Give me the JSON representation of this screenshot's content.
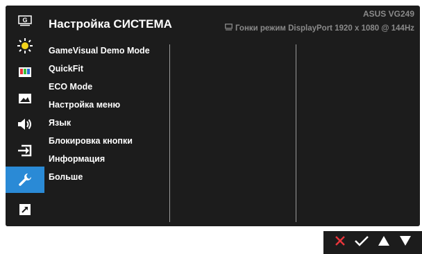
{
  "header": {
    "title": "Настройка СИСТЕМА",
    "model": "ASUS  VG249",
    "status": "Гонки режим DisplayPort  1920 x 1080 @ 144Hz",
    "status_icon": "monitor-icon"
  },
  "sidebar": {
    "items": [
      {
        "icon": "gamevisual-icon",
        "glyph": "G"
      },
      {
        "icon": "blue-light-filter-icon"
      },
      {
        "icon": "color-icon"
      },
      {
        "icon": "image-icon"
      },
      {
        "icon": "sound-icon"
      },
      {
        "icon": "input-select-icon"
      },
      {
        "icon": "system-setup-icon",
        "active": true
      },
      {
        "icon": "shortcut-icon"
      }
    ]
  },
  "menu": {
    "items": [
      {
        "label": "GameVisual Demo Mode"
      },
      {
        "label": "QuickFit"
      },
      {
        "label": "ECO Mode"
      },
      {
        "label": "Настройка меню"
      },
      {
        "label": "Язык"
      },
      {
        "label": "Блокировка кнопки"
      },
      {
        "label": "Информация"
      },
      {
        "label": "Больше"
      }
    ]
  },
  "nav_buttons": [
    {
      "icon": "close-icon",
      "color": "#e8353b"
    },
    {
      "icon": "check-icon",
      "color": "#ffffff"
    },
    {
      "icon": "up-arrow-icon",
      "color": "#ffffff"
    },
    {
      "icon": "down-arrow-icon",
      "color": "#ffffff"
    }
  ],
  "colors": {
    "background": "#1c1c1c",
    "accent": "#2a8ad6",
    "text": "#ffffff",
    "muted": "#8a8a8a",
    "close": "#e8353b",
    "icon_yellow": "#f3d41c"
  }
}
